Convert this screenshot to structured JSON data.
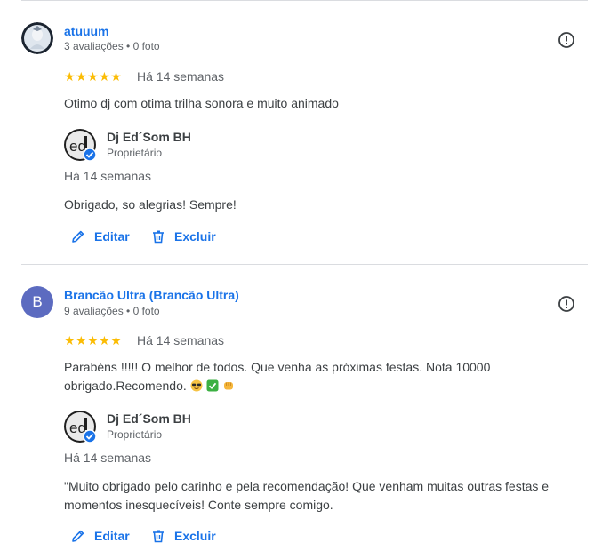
{
  "reviews": [
    {
      "author": "atuuum",
      "meta": "3 avaliações • 0 foto",
      "stars": "★★★★★",
      "time": "Há 14 semanas",
      "text": "Otimo dj com otima trilha sonora e muito animado",
      "owner": {
        "name": "Dj Ed´Som BH",
        "role": "Proprietário",
        "time": "Há 14 semanas",
        "reply": "Obrigado, so alegrias! Sempre!"
      },
      "edit_label": "Editar",
      "delete_label": "Excluir"
    },
    {
      "avatar_letter": "B",
      "author": "Brancão Ultra (Brancão Ultra)",
      "meta": "9 avaliações • 0 foto",
      "stars": "★★★★★",
      "time": "Há 14 semanas",
      "text_line1": "Parabéns !!!!! O melhor de todos. Que venha as próximas festas. Nota 10000",
      "text_line2": "obrigado.Recomendo.",
      "owner": {
        "name": "Dj Ed´Som BH",
        "role": "Proprietário",
        "time": "Há 14 semanas",
        "reply_line1": "\"Muito obrigado pelo carinho e pela recomendação! Que venham muitas outras festas e",
        "reply_line2": "momentos inesquecíveis! Conte sempre comigo."
      },
      "edit_label": "Editar",
      "delete_label": "Excluir"
    }
  ],
  "colors": {
    "link": "#1a73e8",
    "star": "#fbbc04",
    "avatar_b": "#5c6bc0"
  }
}
